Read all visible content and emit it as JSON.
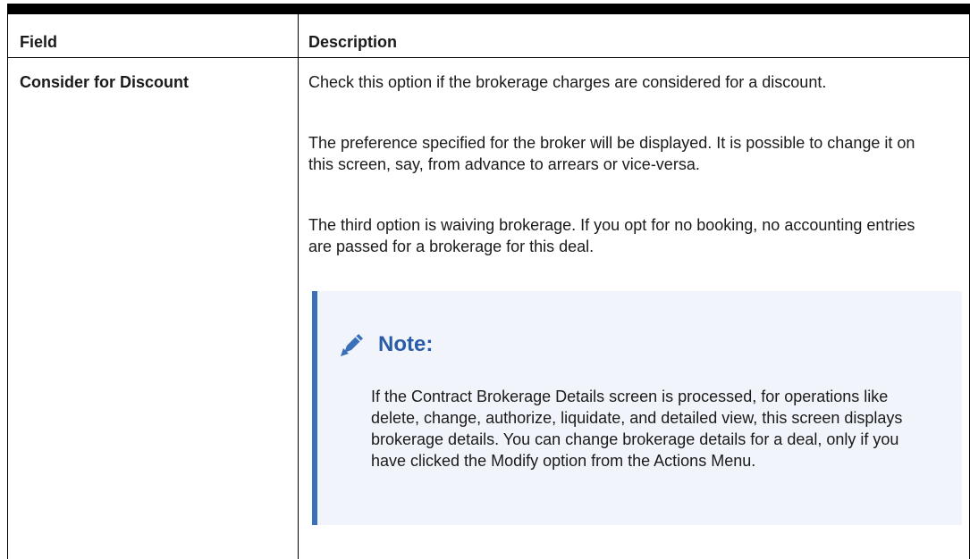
{
  "table": {
    "headers": {
      "field": "Field",
      "description": "Description"
    },
    "rows": [
      {
        "field": "Consider for Discount",
        "paragraphs": [
          "Check this option if the brokerage charges are considered for a discount.",
          "The preference specified for the broker will be displayed. It is possible to change it on this screen, say, from advance to arrears or vice-versa.",
          "The third option is waiving brokerage. If you opt for no booking, no accounting entries are passed for a brokerage for this deal."
        ],
        "note": {
          "icon": "pencil-icon",
          "title": "Note:",
          "text": "If the Contract Brokerage Details screen is processed, for operations like delete, change, authorize, liquidate, and detailed view, this screen displays brokerage details. You can change brokerage details for a deal, only if you have clicked the Modify option from the Actions Menu."
        }
      }
    ]
  },
  "colors": {
    "rule": "#000000",
    "note_background": "#f1f5fb",
    "note_accent": "#3a6fba",
    "note_title": "#2a5ba8"
  }
}
